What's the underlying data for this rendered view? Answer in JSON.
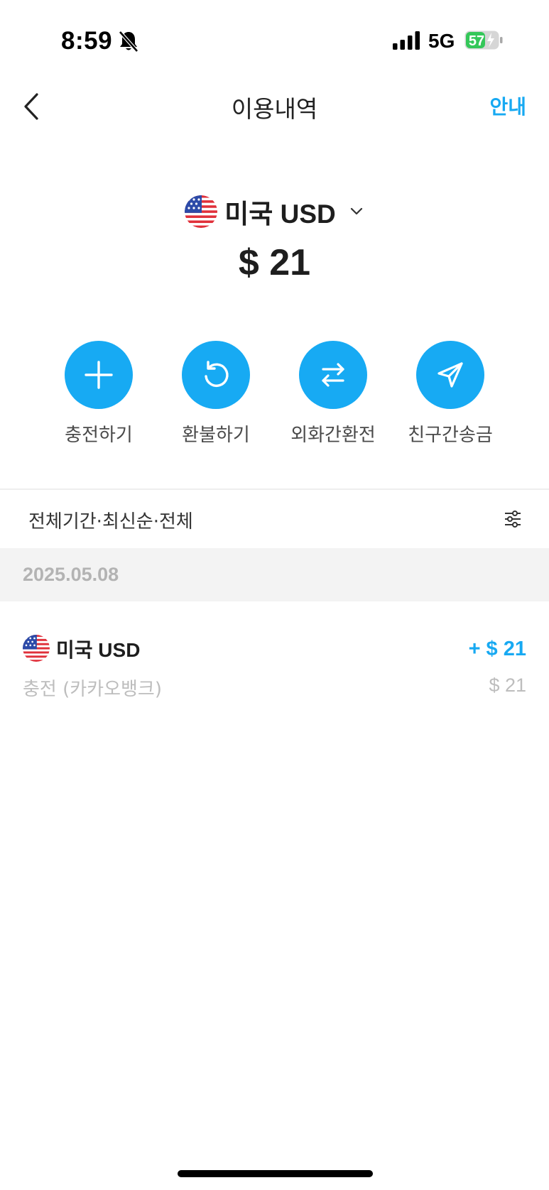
{
  "status_bar": {
    "time": "8:59",
    "network": "5G",
    "battery_level": "57",
    "icons": [
      "bell-muted-icon",
      "signal-icon",
      "battery-icon"
    ]
  },
  "nav": {
    "title": "이용내역",
    "help_label": "안내",
    "back_icon": "chevron-left-icon"
  },
  "wallet": {
    "currency_label": "미국 USD",
    "balance": "$ 21",
    "flag_icon": "us-flag-icon"
  },
  "actions": [
    {
      "label": "충전하기",
      "icon": "plus-icon"
    },
    {
      "label": "환불하기",
      "icon": "refresh-icon"
    },
    {
      "label": "외화간환전",
      "icon": "swap-arrows-icon"
    },
    {
      "label": "친구간송금",
      "icon": "send-icon"
    }
  ],
  "filter": {
    "label": "전체기간·최신순·전체",
    "icon": "sliders-icon"
  },
  "history": [
    {
      "date": "2025.05.08",
      "items": [
        {
          "currency": "미국 USD",
          "amount": "+ $ 21",
          "description": "충전 (카카오뱅크)",
          "sub_amount": "$ 21"
        }
      ]
    }
  ],
  "colors": {
    "accent": "#17aaf3",
    "text_primary": "#1e1e1e",
    "text_muted": "#bdbdbd",
    "date_bg": "#f3f3f3",
    "battery_green": "#34c759"
  }
}
